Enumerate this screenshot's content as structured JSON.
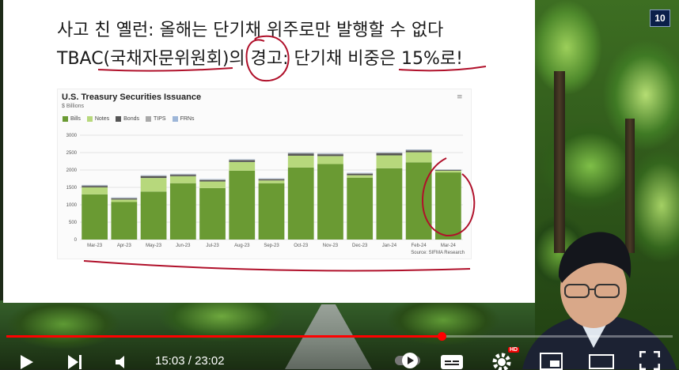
{
  "slide": {
    "title_line1": "사고 친 옐런: 올해는 단기채 위주로만 발행할 수 없다",
    "title_line2": "TBAC(국채자문위원회)의 경고: 단기채 비중은 15%로!",
    "page_number": "10"
  },
  "chart": {
    "title": "U.S. Treasury Securities Issuance",
    "subtitle": "$ Billions",
    "source": "Source: SIFMA Research",
    "menu_glyph": "≡"
  },
  "chart_data": {
    "type": "bar",
    "stacked": true,
    "categories": [
      "Mar-23",
      "Apr-23",
      "May-23",
      "Jun-23",
      "Jul-23",
      "Aug-23",
      "Sep-23",
      "Oct-23",
      "Nov-23",
      "Dec-23",
      "Jan-24",
      "Feb-24",
      "Mar-24"
    ],
    "series": [
      {
        "name": "Bills",
        "color": "#6a9a33",
        "values": [
          1300,
          1080,
          1380,
          1620,
          1480,
          1980,
          1620,
          2070,
          2170,
          1780,
          2050,
          2220,
          1930
        ]
      },
      {
        "name": "Notes",
        "color": "#b7d87c",
        "values": [
          200,
          70,
          390,
          200,
          190,
          250,
          80,
          340,
          230,
          70,
          370,
          290,
          50
        ]
      },
      {
        "name": "Bonds",
        "color": "#555555",
        "values": [
          40,
          30,
          50,
          40,
          40,
          50,
          30,
          60,
          50,
          40,
          60,
          50,
          20
        ]
      },
      {
        "name": "TIPS",
        "color": "#a9a9a9",
        "values": [
          20,
          20,
          20,
          20,
          20,
          20,
          20,
          20,
          20,
          20,
          20,
          20,
          10
        ]
      },
      {
        "name": "FRNs",
        "color": "#9db6d8",
        "values": [
          10,
          10,
          10,
          10,
          10,
          10,
          10,
          10,
          10,
          10,
          10,
          10,
          5
        ]
      }
    ],
    "y_ticks": [
      "0",
      "500",
      "1000",
      "1500",
      "2000",
      "2500",
      "3000"
    ],
    "ylim": [
      0,
      3000
    ],
    "grid": true,
    "legend_position": "top-left"
  },
  "player": {
    "time_current": "15:03",
    "time_separator": " / ",
    "time_total": "23:02",
    "progress_fraction": 0.653,
    "hd_label": "HD",
    "accent_color": "#ff0000"
  },
  "icons": [
    "play-icon",
    "next-icon",
    "volume-icon",
    "autoplay-toggle-icon",
    "subtitles-icon",
    "settings-gear-icon",
    "miniplayer-icon",
    "theater-mode-icon",
    "fullscreen-icon"
  ]
}
